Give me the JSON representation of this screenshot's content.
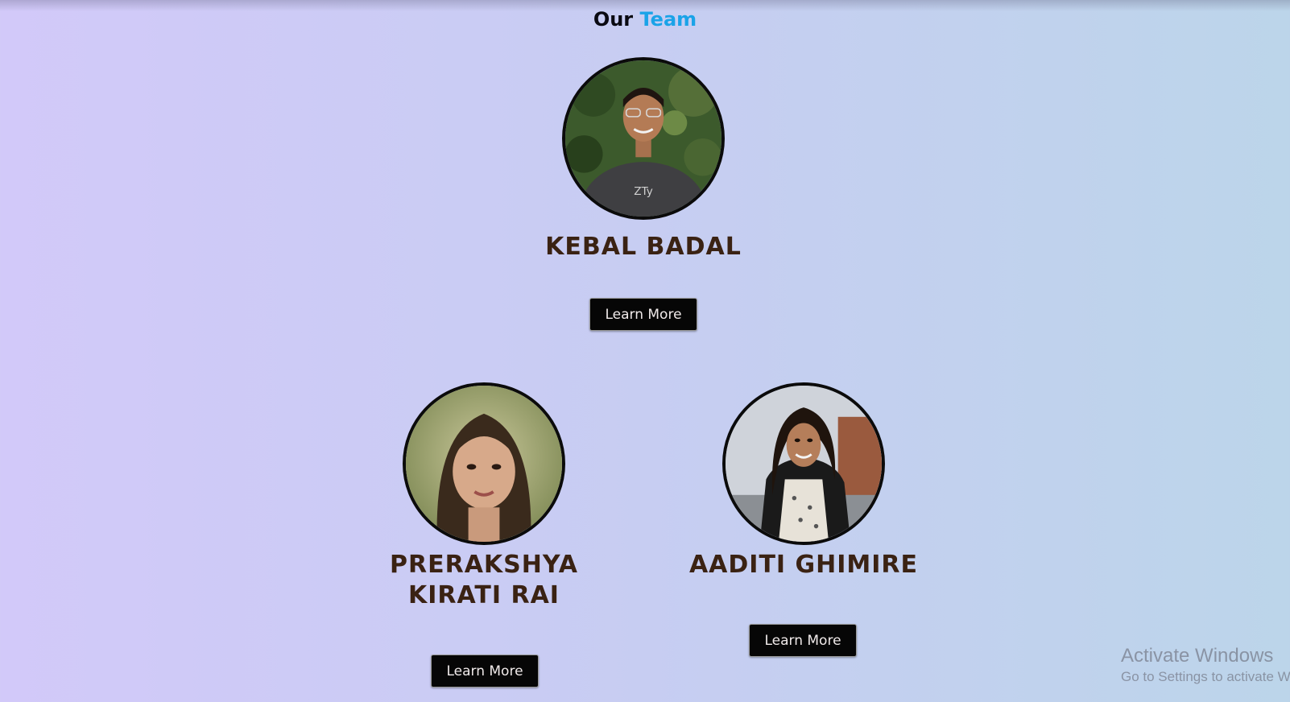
{
  "page": {
    "title_main": "Our",
    "title_accent": "Team",
    "accent_color": "#1aa3e8"
  },
  "team": [
    {
      "name": "KEBAL BADAL",
      "button_label": "Learn More",
      "photo_icon": "kebal-badal-photo"
    },
    {
      "name": "PRERAKSHYA KIRATI RAI",
      "button_label": "Learn More",
      "photo_icon": "prerakshya-kirati-rai-photo"
    },
    {
      "name": "AADITI GHIMIRE",
      "button_label": "Learn More",
      "photo_icon": "aaditi-ghimire-photo"
    }
  ],
  "watermark": {
    "title": "Activate Windows",
    "subtitle": "Go to Settings to activate Windows."
  }
}
